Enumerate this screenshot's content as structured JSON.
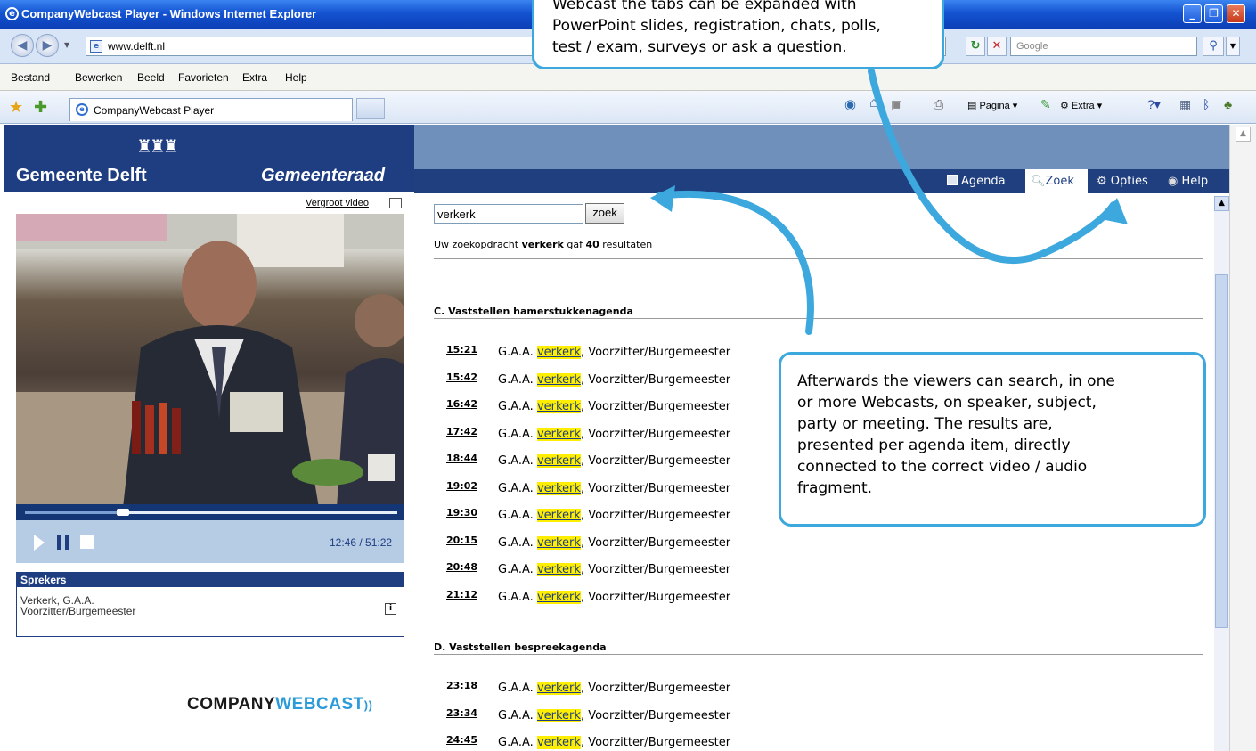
{
  "window": {
    "title": "CompanyWebcast Player - Windows Internet Explorer",
    "url": "www.delft.nl",
    "search_placeholder": "Google"
  },
  "menu": [
    "Bestand",
    "Bewerken",
    "Beeld",
    "Favorieten",
    "Extra",
    "Help"
  ],
  "tab": {
    "title": "CompanyWebcast Player"
  },
  "command_bar": {
    "page": "Pagina",
    "tools": "Extra"
  },
  "brand": {
    "left": "Gemeente Delft",
    "right": "Gemeenteraad"
  },
  "player": {
    "enlarge_link": "Vergroot video",
    "timecode": "12:46 / 51:22",
    "progress": 0.25
  },
  "speakers": {
    "heading": "Sprekers",
    "name": "Verkerk, G.A.A.",
    "role": "Voorzitter/Burgemeester"
  },
  "logo": {
    "part1": "COMPANY",
    "part2": "WEBCAST"
  },
  "tabs": [
    {
      "label": "Agenda",
      "icon": "agenda-icon",
      "active": false
    },
    {
      "label": "Zoek",
      "icon": "magnifier-icon",
      "active": true
    },
    {
      "label": "Opties",
      "icon": "gear-icon",
      "active": false
    },
    {
      "label": "Help",
      "icon": "help-icon",
      "active": false
    }
  ],
  "search": {
    "value": "verkerk",
    "button": "zoek",
    "summary_prefix": "Uw zoekopdracht",
    "summary_term": "verkerk",
    "summary_mid": "gaf",
    "summary_count": "40",
    "summary_suffix": "resultaten"
  },
  "results": {
    "sections": [
      {
        "title": "C. Vaststellen hamerstukkenagenda",
        "items": [
          {
            "time": "15:21",
            "pre": "G.A.A.",
            "highlight": "verkerk",
            "post": ", Voorzitter/Burgemeester"
          },
          {
            "time": "15:42",
            "pre": "G.A.A.",
            "highlight": "verkerk",
            "post": ", Voorzitter/Burgemeester"
          },
          {
            "time": "16:42",
            "pre": "G.A.A.",
            "highlight": "verkerk",
            "post": ", Voorzitter/Burgemeester"
          },
          {
            "time": "17:42",
            "pre": "G.A.A.",
            "highlight": "verkerk",
            "post": ", Voorzitter/Burgemeester"
          },
          {
            "time": "18:44",
            "pre": "G.A.A.",
            "highlight": "verkerk",
            "post": ", Voorzitter/Burgemeester"
          },
          {
            "time": "19:02",
            "pre": "G.A.A.",
            "highlight": "verkerk",
            "post": ", Voorzitter/Burgemeester"
          },
          {
            "time": "19:30",
            "pre": "G.A.A.",
            "highlight": "verkerk",
            "post": ", Voorzitter/Burgemeester"
          },
          {
            "time": "20:15",
            "pre": "G.A.A.",
            "highlight": "verkerk",
            "post": ", Voorzitter/Burgemeester"
          },
          {
            "time": "20:48",
            "pre": "G.A.A.",
            "highlight": "verkerk",
            "post": ", Voorzitter/Burgemeester"
          },
          {
            "time": "21:12",
            "pre": "G.A.A.",
            "highlight": "verkerk",
            "post": ", Voorzitter/Burgemeester"
          }
        ]
      },
      {
        "title": "D. Vaststellen bespreekagenda",
        "items": [
          {
            "time": "23:18",
            "pre": "G.A.A.",
            "highlight": "verkerk",
            "post": ", Voorzitter/Burgemeester"
          },
          {
            "time": "23:34",
            "pre": "G.A.A.",
            "highlight": "verkerk",
            "post": ", Voorzitter/Burgemeester"
          },
          {
            "time": "24:45",
            "pre": "G.A.A.",
            "highlight": "verkerk",
            "post": ", Voorzitter/Burgemeester"
          }
        ]
      }
    ]
  },
  "callouts": {
    "top": [
      "Webcast the tabs can be expanded with",
      "PowerPoint slides, registration, chats, polls,",
      "test / exam, surveys or ask a question."
    ],
    "right": [
      "Afterwards the viewers can search, in one",
      "or more Webcasts, on speaker, subject,",
      "party or meeting. The results are,",
      "presented per agenda item, directly",
      "connected to the correct video / audio",
      "fragment."
    ]
  },
  "colors": {
    "brand_blue": "#1f3e82",
    "accent": "#3da8dd",
    "highlight": "#ffee00"
  }
}
